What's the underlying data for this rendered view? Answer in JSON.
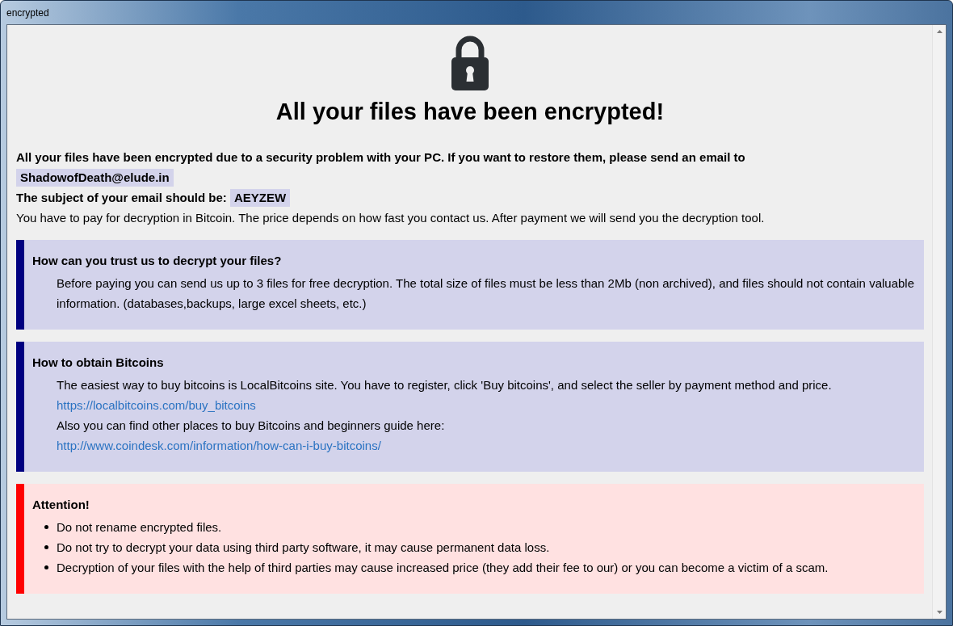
{
  "window": {
    "title": "encrypted"
  },
  "header": {
    "title": "All your files have been encrypted!"
  },
  "intro": {
    "text": "All your files have been encrypted due to a security problem with your PC. If you want to restore them, please send an email to",
    "email": "ShadowofDeath@elude.in",
    "subject_label": "The subject of your email should be:",
    "subject_code": "AEYZEW",
    "payment_note": "You have to pay for decryption in Bitcoin. The price depends on how fast you contact us. After payment we will send you the decryption tool."
  },
  "sections": [
    {
      "kind": "info",
      "heading": "How can you trust us to decrypt your files?",
      "lines": [
        {
          "kind": "text",
          "text": "Before paying you can send us up to 3 files for free decryption. The total size of files must be less than 2Mb (non archived), and files should not contain valuable information. (databases,backups, large excel sheets, etc.)"
        }
      ]
    },
    {
      "kind": "info",
      "heading": "How to obtain Bitcoins",
      "lines": [
        {
          "kind": "text",
          "text": "The easiest way to buy bitcoins is LocalBitcoins site. You have to register, click 'Buy bitcoins', and select the seller by payment method and price."
        },
        {
          "kind": "link",
          "text": "https://localbitcoins.com/buy_bitcoins"
        },
        {
          "kind": "text",
          "text": "Also you can find other places to buy Bitcoins and beginners guide here:"
        },
        {
          "kind": "link",
          "text": "http://www.coindesk.com/information/how-can-i-buy-bitcoins/"
        }
      ]
    },
    {
      "kind": "warning",
      "heading": "Attention!",
      "lines": [
        {
          "kind": "bullet",
          "text": "Do not rename encrypted files."
        },
        {
          "kind": "bullet",
          "text": "Do not try to decrypt your data using third party software, it may cause permanent data loss."
        },
        {
          "kind": "bullet",
          "text": "Decryption of your files with the help of third parties may cause increased price (they add their fee to our) or you can become a victim of a scam."
        }
      ]
    }
  ]
}
